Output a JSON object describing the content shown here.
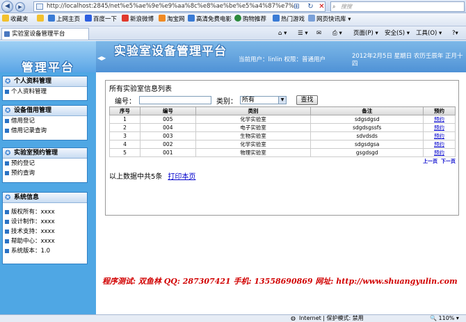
{
  "browser": {
    "url": "http://localhost:2845/net%e5%ae%9e%e9%aa%8c%e8%ae%be%e5%a4%87%e7%",
    "search_placeholder": "搜搜",
    "favorites_label": "收藏夹",
    "favorites": [
      "上网主页",
      "百度一下",
      "新浪微博",
      "淘宝网",
      "高清免费电影",
      "购物推荐",
      "热门游戏",
      "网页快讯库"
    ],
    "tab_title": "实验室设备管理平台",
    "commands": {
      "page": "页面(P)",
      "safety": "安全(S)",
      "tools": "工具(O)"
    },
    "status_zone": "Internet | 保护模式: 禁用",
    "zoom": "110%"
  },
  "header": {
    "logo": "管理平台",
    "title": "实验室设备管理平台",
    "user_label": "当前用户：",
    "user": "linlin",
    "role_label": "权限：",
    "role": "普通用户",
    "date": "2012年2月5日 星期日 农历壬辰年 正月十四"
  },
  "sidebar": {
    "personal": {
      "title": "个人资料管理",
      "items": [
        "个人资料管理"
      ]
    },
    "equipment": {
      "title": "设备借用管理",
      "items": [
        "借用登记",
        "借用记录查询"
      ]
    },
    "booking": {
      "title": "实验室预约管理",
      "items": [
        "预约登记",
        "预约查询"
      ]
    },
    "sysinfo": {
      "title": "系统信息",
      "items": [
        "版权所有：xxxx",
        "设计制作：xxxx",
        "技术支持：xxxx",
        "帮助中心：xxxx",
        "系统版本：1.0"
      ]
    }
  },
  "main": {
    "panel_title": "所有实验室信息列表",
    "number_label": "编号：",
    "number_value": "",
    "category_label": "类别：",
    "category_value": "所有",
    "query_button": "查找",
    "columns": [
      "序号",
      "编号",
      "类别",
      "备注",
      "预约"
    ],
    "rows": [
      [
        "1",
        "005",
        "化学实验室",
        "sdgsdgsd",
        "预约"
      ],
      [
        "2",
        "004",
        "电子实验室",
        "sdgdsgssfs",
        "预约"
      ],
      [
        "3",
        "003",
        "生物实验室",
        "sdvdsds",
        "预约"
      ],
      [
        "4",
        "002",
        "化学实验室",
        "sdgsdgsa",
        "预约"
      ],
      [
        "5",
        "001",
        "物理实验室",
        "gsgdsgd",
        "预约"
      ]
    ],
    "prev_page": "上一页",
    "next_page": "下一页",
    "summary": "以上数据中共5条",
    "print": "打印本页"
  },
  "footer": {
    "credits": "程序测试: 双鱼林    QQ: 287307421    手机: 13558690869    网址: http://www.shuangyulin.com"
  }
}
